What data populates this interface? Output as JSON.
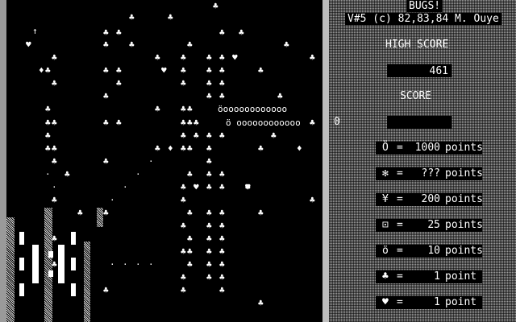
{
  "header": {
    "title": "BUGS!",
    "version_line": "V#5 (c) 82,83,84 M. Ouye"
  },
  "high_score": {
    "label": "HIGH SCORE",
    "value": "461"
  },
  "score": {
    "label": "SCORE",
    "value": "",
    "side_value": "0"
  },
  "points_table": [
    {
      "icon": "Ö",
      "eq": "=",
      "value": "1000",
      "unit": "points"
    },
    {
      "icon": "✻",
      "eq": "=",
      "value": "???",
      "unit": "points"
    },
    {
      "icon": "¥",
      "eq": "=",
      "value": "200",
      "unit": "points"
    },
    {
      "icon": "⊡",
      "eq": "=",
      "value": "25",
      "unit": "points"
    },
    {
      "icon": "ö",
      "eq": "=",
      "value": "10",
      "unit": "points"
    },
    {
      "icon": "♣",
      "eq": "=",
      "value": "1",
      "unit": "point"
    },
    {
      "icon": "♥",
      "eq": "=",
      "value": "1",
      "unit": "point"
    }
  ],
  "centipede": {
    "head": "ö",
    "segments": "oooooooooooo"
  },
  "icons": {
    "mushroom": "♣",
    "flea": "♥",
    "diamond": "♦",
    "shot": "↑",
    "player": "player-ship"
  },
  "colors": {
    "playfield": "#000000",
    "sidebar": "#9c9c9c",
    "divider": "#bdbdbd",
    "text": "#ffffff"
  }
}
